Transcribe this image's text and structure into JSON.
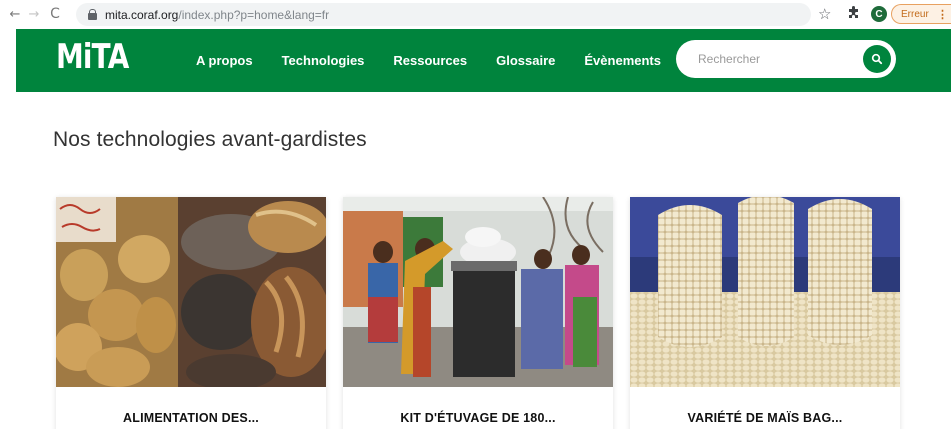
{
  "browser": {
    "url_host": "mita.coraf.org",
    "url_path": "/index.php?p=home&lang=fr",
    "profile_initial": "C",
    "error_label": "Erreur"
  },
  "site": {
    "logo": "MiTA",
    "nav": [
      {
        "label": "A propos"
      },
      {
        "label": "Technologies"
      },
      {
        "label": "Ressources"
      },
      {
        "label": "Glossaire"
      },
      {
        "label": "Évènements"
      }
    ],
    "search": {
      "placeholder": "Rechercher"
    }
  },
  "main": {
    "section_title": "Nos technologies avant-gardistes",
    "cards": [
      {
        "title": "ALIMENTATION DES..."
      },
      {
        "title": "KIT D'ÉTUVAGE DE 180..."
      },
      {
        "title": "VARIÉTÉ DE MAÏS BAG..."
      }
    ]
  },
  "colors": {
    "brand_green": "#00843d",
    "error_orange": "#c26a1a"
  }
}
